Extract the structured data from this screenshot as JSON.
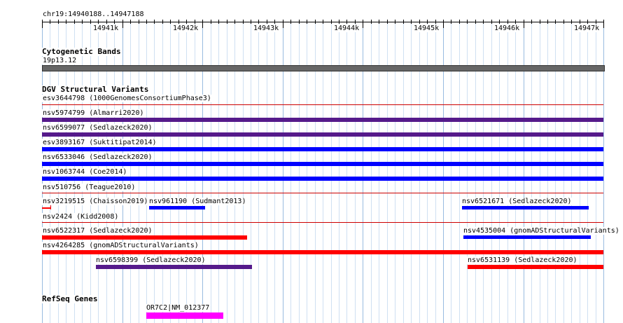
{
  "ruler": {
    "locus": "chr19:14940188..14947188",
    "ticks": [
      "14941k",
      "14942k",
      "14943k",
      "14944k",
      "14945k",
      "14946k",
      "14947k"
    ]
  },
  "cytoband": {
    "title": "Cytogenetic Bands",
    "band": "19p13.12",
    "color": "#666666"
  },
  "dgv": {
    "title": "DGV Structural Variants",
    "colors": {
      "loss": "#ff0000",
      "gain": "#0000ff",
      "both": "#551a8b",
      "separator": "#cc0000"
    },
    "features": [
      {
        "label": "esv3644798 (1000GenomesConsortiumPhase3)",
        "color": "none"
      },
      {
        "label": "nsv5974799 (Almarri2020)",
        "color": "#551a8b"
      },
      {
        "label": "nsv6599077 (Sedlazeck2020)",
        "color": "#551a8b"
      },
      {
        "label": "esv3893167 (Suktitipat2014)",
        "color": "#0000ff"
      },
      {
        "label": "nsv6533046 (Sedlazeck2020)",
        "color": "#0000ff"
      },
      {
        "label": "nsv1063744 (Coe2014)",
        "color": "#0000ff"
      },
      {
        "label": "nsv510756 (Teague2010)",
        "color": "none"
      },
      {
        "label": "nsv3219515 (Chaisson2019)",
        "color": "#ff0000"
      },
      {
        "label": "nsv961190 (Sudmant2013)",
        "color": "#0000ff"
      },
      {
        "label": "nsv6521671 (Sedlazeck2020)",
        "color": "#0000ff"
      },
      {
        "label": "nsv2424 (Kidd2008)",
        "color": "none"
      },
      {
        "label": "nsv6522317 (Sedlazeck2020)",
        "color": "#ff0000"
      },
      {
        "label": "nsv4535004 (gnomADStructuralVariants)",
        "color": "#0000ff"
      },
      {
        "label": "nsv4264285 (gnomADStructuralVariants)",
        "color": "#ff0000"
      },
      {
        "label": "nsv6598399 (Sedlazeck2020)",
        "color": "#551a8b"
      },
      {
        "label": "nsv6531139 (Sedlazeck2020)",
        "color": "#ff0000"
      }
    ]
  },
  "refseq": {
    "title": "RefSeq Genes",
    "gene_label": "OR7C2|NM_012377",
    "color": "#ff00ff"
  }
}
